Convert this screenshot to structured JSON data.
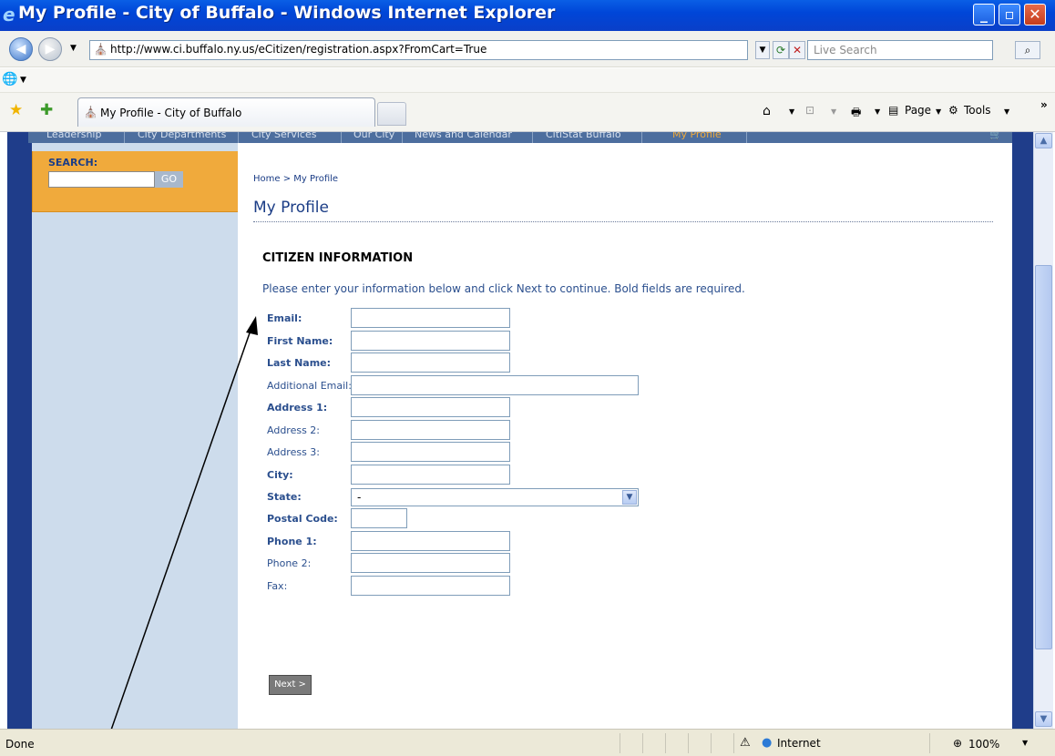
{
  "window": {
    "title": "My Profile - City of Buffalo - Windows Internet Explorer",
    "minimize": "_",
    "maximize": "▫",
    "close": "✕"
  },
  "addressbar": {
    "url": "http://www.ci.buffalo.ny.us/eCitizen/registration.aspx?FromCart=True",
    "search_placeholder": "Live Search"
  },
  "tabs": {
    "active_label": "My Profile - City of Buffalo"
  },
  "commandbar": {
    "page_label": "Page",
    "tools_label": "Tools",
    "chevron": "»"
  },
  "site_nav": {
    "items": [
      "Leadership",
      "City Departments",
      "City Services",
      "Our City",
      "News and Calendar",
      "CitiStat Buffalo",
      "My Profile"
    ]
  },
  "search_panel": {
    "label": "SEARCH:",
    "button": "GO"
  },
  "content": {
    "breadcrumb": "Home > My Profile",
    "page_title": "My Profile",
    "section_heading": "CITIZEN INFORMATION",
    "instructions": "Please enter your information below and click Next to continue. Bold fields are required.",
    "fields": [
      {
        "label": "Email:",
        "required": true
      },
      {
        "label": "First Name:",
        "required": true
      },
      {
        "label": "Last Name:",
        "required": true
      },
      {
        "label": "Additional Email:",
        "required": false
      },
      {
        "label": "Address 1:",
        "required": true
      },
      {
        "label": "Address 2:",
        "required": false
      },
      {
        "label": "Address 3:",
        "required": false
      },
      {
        "label": "City:",
        "required": true
      },
      {
        "label": "State:",
        "required": true
      },
      {
        "label": "Postal Code:",
        "required": true
      },
      {
        "label": "Phone 1:",
        "required": true
      },
      {
        "label": "Phone 2:",
        "required": false
      },
      {
        "label": "Fax:",
        "required": false
      }
    ],
    "state_value": "-",
    "next_button": "Next >"
  },
  "statusbar": {
    "status": "Done",
    "zone": "Internet",
    "zoom": "100%"
  }
}
